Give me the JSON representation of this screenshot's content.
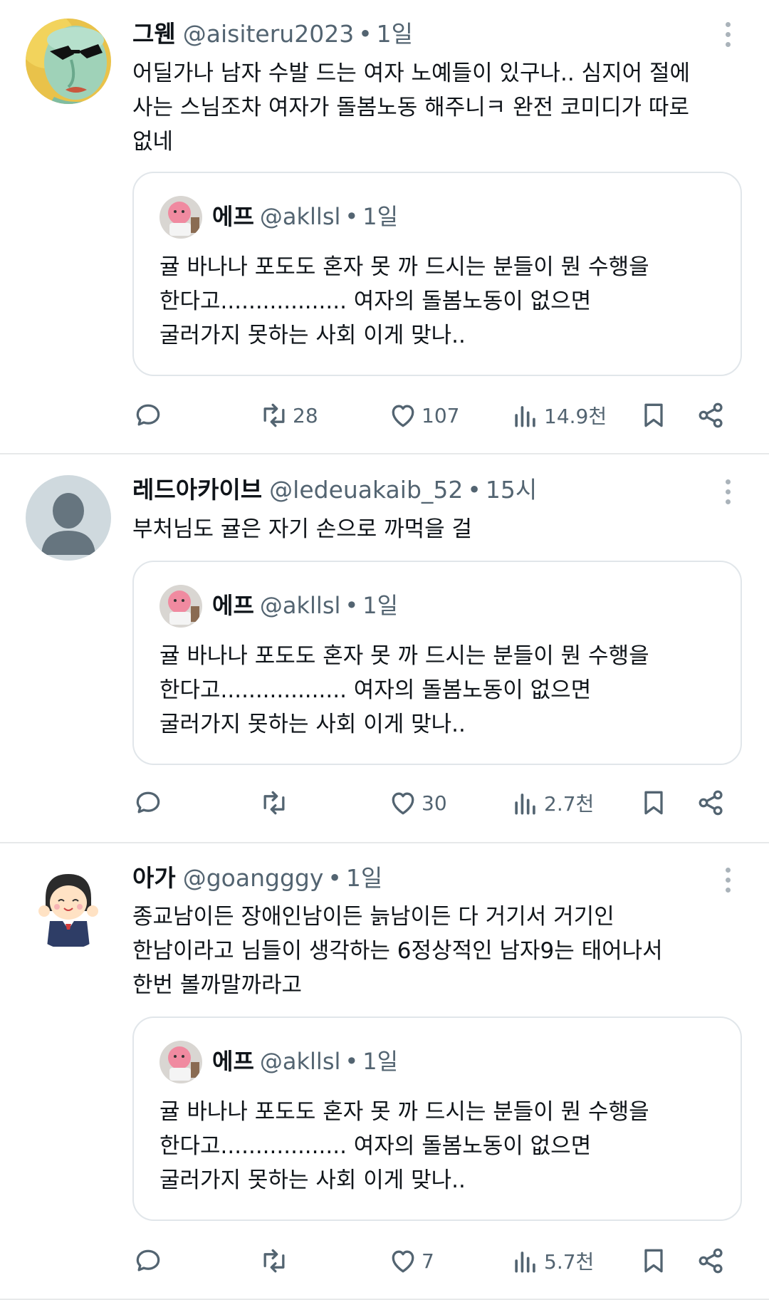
{
  "tweets": [
    {
      "name": "그웬",
      "handle": "@aisiteru2023",
      "time": "1일",
      "text": [
        "어딜가나 남자 수발 드는 여자 노예들이 있구나.. 심지어 절에",
        "사는 스님조차 여자가 돌봄노동 해주니ㅋ 완전 코미디가 따로",
        "없네"
      ],
      "quote": {
        "name": "에프",
        "handle": "@akllsl",
        "time": "1일",
        "text": [
          "귤 바나나 포도도 혼자 못 까 드시는 분들이 뭔 수행을",
          "한다고.................. 여자의 돌봄노동이 없으면",
          "굴러가지 못하는 사회 이게 맞나.."
        ]
      },
      "stats": {
        "reposts": "28",
        "likes": "107",
        "views": "14.9천"
      }
    },
    {
      "name": "레드아카이브",
      "handle": "@ledeuakaib_52",
      "time": "15시",
      "text": [
        "부처님도 귤은 자기 손으로 까먹을 걸"
      ],
      "quote": {
        "name": "에프",
        "handle": "@akllsl",
        "time": "1일",
        "text": [
          "귤 바나나 포도도 혼자 못 까 드시는 분들이 뭔 수행을",
          "한다고.................. 여자의 돌봄노동이 없으면",
          "굴러가지 못하는 사회 이게 맞나.."
        ]
      },
      "stats": {
        "reposts": "",
        "likes": "30",
        "views": "2.7천"
      }
    },
    {
      "name": "아가",
      "handle": "@goangggy",
      "time": "1일",
      "text": [
        "종교남이든 장애인남이든 늙남이든 다 거기서 거기인",
        "한남이라고 님들이 생각하는 6정상적인 남자9는 태어나서",
        "한번 볼까말까라고"
      ],
      "quote": {
        "name": "에프",
        "handle": "@akllsl",
        "time": "1일",
        "text": [
          "귤 바나나 포도도 혼자 못 까 드시는 분들이 뭔 수행을",
          "한다고.................. 여자의 돌봄노동이 없으면",
          "굴러가지 못하는 사회 이게 맞나.."
        ]
      },
      "stats": {
        "reposts": "",
        "likes": "7",
        "views": "5.7천"
      }
    }
  ],
  "separators": [
    "•",
    "•",
    "•"
  ],
  "icons": [
    "reply-icon",
    "repost-icon",
    "like-icon",
    "views-icon",
    "bookmark-icon",
    "share-icon",
    "more-icon"
  ],
  "colors": {
    "text": "#0f1419",
    "secondary": "#536471",
    "border": "#e1e6ea"
  }
}
